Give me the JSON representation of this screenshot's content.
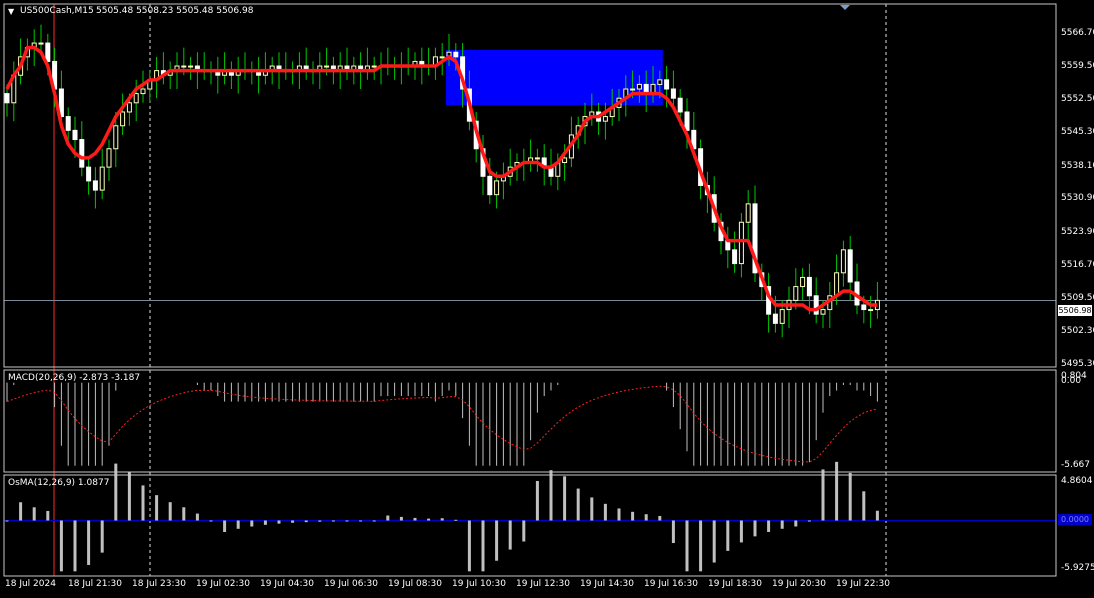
{
  "header": {
    "menu_glyph": "▼",
    "symbol": "US500Cash,M15",
    "ohlc": "5505.48 5508.23 5505.48 5506.98"
  },
  "price_scale": {
    "labels": [
      "5566.70",
      "5559.50",
      "5552.50",
      "5545.30",
      "5538.10",
      "5530.90",
      "5523.90",
      "5516.70",
      "5509.50",
      "5502.30",
      "5495.30"
    ],
    "current_price": "5506.98"
  },
  "macd_panel": {
    "title": "MACD(20,26,9) -2.873 -3.187",
    "scale_top_1": "0.804",
    "scale_top_2": "0.00",
    "scale_bottom": "-5.667"
  },
  "osma_panel": {
    "title": "OsMA(12,26,9) 1.0877",
    "scale_top": "4.8604",
    "scale_zero": "0.0000",
    "scale_bottom": "-5.9275"
  },
  "time_axis": [
    "18 Jul 2024",
    "18 Jul 21:30",
    "18 Jul 23:30",
    "19 Jul 02:30",
    "19 Jul 04:30",
    "19 Jul 06:30",
    "19 Jul 08:30",
    "19 Jul 10:30",
    "19 Jul 12:30",
    "19 Jul 14:30",
    "19 Jul 16:30",
    "19 Jul 18:30",
    "19 Jul 20:30",
    "19 Jul 22:30"
  ],
  "colors": {
    "background": "#000000",
    "frame": "#c8c8c8",
    "bull_candle": "#ffffc0",
    "bear_candle": "#ffffff",
    "wick": "#00c800",
    "moving_average": "#ff1a1a",
    "zone_rectangle": "#0000ff",
    "macd_signal": "#ff2020",
    "histogram": "#c0c0c0",
    "osma_zero_line": "#0000c8",
    "price_line": "#7a8a9a"
  },
  "chart_data": {
    "type": "candlestick",
    "symbol": "US500Cash",
    "timeframe": "M15",
    "price_range": [
      5492.5,
      5571.5
    ],
    "close": [
      5550,
      5556,
      5560,
      5562,
      5563,
      5563,
      5559,
      5553,
      5547,
      5544,
      5542,
      5536,
      5533,
      5531,
      5536,
      5540,
      5545,
      5548,
      5550,
      5552,
      5553,
      5555,
      5557,
      5556,
      5557,
      5558,
      5558,
      5558,
      5557,
      5557,
      5557,
      5556,
      5557,
      5556,
      5557,
      5557,
      5557,
      5556,
      5557,
      5558,
      5557,
      5557,
      5557,
      5558,
      5557,
      5557,
      5558,
      5558,
      5557,
      5558,
      5557,
      5558,
      5557,
      5558,
      5558,
      5558,
      5558,
      5558,
      5558,
      5558,
      5559,
      5558,
      5558,
      5560,
      5560,
      5561,
      5560,
      5553,
      5546,
      5540,
      5534,
      5530,
      5533,
      5534,
      5536,
      5537,
      5537,
      5538,
      5538,
      5536,
      5534,
      5537,
      5538,
      5543,
      5545,
      5547,
      5548,
      5546,
      5547,
      5549,
      5551,
      5553,
      5553,
      5554,
      5552,
      5554,
      5555,
      5553,
      5551,
      5548,
      5544,
      5540,
      5532,
      5530,
      5524,
      5520,
      5518,
      5515,
      5524,
      5528,
      5513,
      5510,
      5504,
      5502,
      5505,
      5507,
      5510,
      5512,
      5508,
      5504,
      5505,
      5508,
      5513,
      5518,
      5511,
      5506,
      5505,
      5505,
      5507
    ],
    "moving_average": [
      5553,
      5556,
      5558,
      5562,
      5562,
      5561,
      5558,
      5552,
      5545,
      5541,
      5539,
      5538,
      5538,
      5539,
      5541,
      5544,
      5547,
      5549,
      5551,
      5553,
      5554,
      5555,
      5555,
      5556,
      5557,
      5557,
      5557,
      5557,
      5557,
      5557,
      5557,
      5557,
      5557,
      5557,
      5557,
      5557,
      5557,
      5557,
      5557,
      5557,
      5557,
      5557,
      5557,
      5557,
      5557,
      5557,
      5557,
      5557,
      5557,
      5557,
      5557,
      5557,
      5557,
      5557,
      5557,
      5558,
      5558,
      5558,
      5558,
      5558,
      5558,
      5558,
      5558,
      5558,
      5559,
      5560,
      5559,
      5555,
      5550,
      5544,
      5539,
      5535,
      5534,
      5534,
      5535,
      5536,
      5537,
      5537,
      5537,
      5536,
      5536,
      5537,
      5539,
      5541,
      5543,
      5546,
      5547,
      5547,
      5548,
      5549,
      5550,
      5551,
      5552,
      5552,
      5552,
      5552,
      5552,
      5551,
      5549,
      5546,
      5543,
      5539,
      5535,
      5531,
      5527,
      5523,
      5520,
      5520,
      5520,
      5520,
      5516,
      5512,
      5508,
      5506,
      5506,
      5506,
      5506,
      5506,
      5505,
      5505,
      5506,
      5507,
      5508,
      5509,
      5509,
      5508,
      5507,
      5506,
      5506
    ],
    "zone": {
      "price_top": 5561.5,
      "price_bottom": 5549.5,
      "from_bar": 65,
      "to_bar": 96
    },
    "current_price": 5506.98,
    "macd": {
      "params": [
        20,
        26,
        9
      ],
      "main": -2.873,
      "signal": -3.187,
      "scale": [
        -5.667,
        0.804
      ]
    },
    "osma": {
      "params": [
        12,
        26,
        9
      ],
      "value": 1.0877,
      "scale": [
        -5.9275,
        4.8604
      ]
    }
  }
}
